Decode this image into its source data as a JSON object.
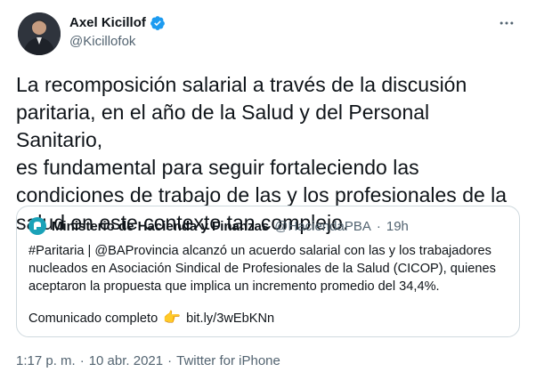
{
  "author": {
    "display_name": "Axel Kicillof",
    "handle": "@Kicillofok",
    "verified": true
  },
  "more_icon": "more-horizontal-icon",
  "tweet_text": "La recomposición salarial a través de la discusión\nparitaria, en el año de la Salud y del Personal Sanitario,\nes fundamental para seguir fortaleciendo las\ncondiciones de trabajo de las y los profesionales de la\nsalud en este contexto tan complejo.",
  "quoted": {
    "display_name": "Ministerio de Hacienda y Finanzas",
    "handle": "@HaciendaPBA",
    "separator": "·",
    "time": "19h",
    "text": "#Paritaria | @BAProvincia alcanzó un acuerdo salarial con las y los trabajadores nucleados en Asociación Sindical de Profesionales de la Salud (CICOP), quienes aceptaron la propuesta que implica un incremento promedio del 34,4%.",
    "cta_text": "Comunicado completo",
    "cta_emoji": "👉",
    "link": "bit.ly/3wEbKNn"
  },
  "meta": {
    "time": "1:17 p. m.",
    "sep1": "·",
    "date": "10 abr. 2021",
    "sep2": "·",
    "source": "Twitter for iPhone"
  },
  "colors": {
    "text": "#0f1419",
    "secondary": "#536471",
    "verified": "#1d9bf0",
    "border": "#cfd9de"
  }
}
